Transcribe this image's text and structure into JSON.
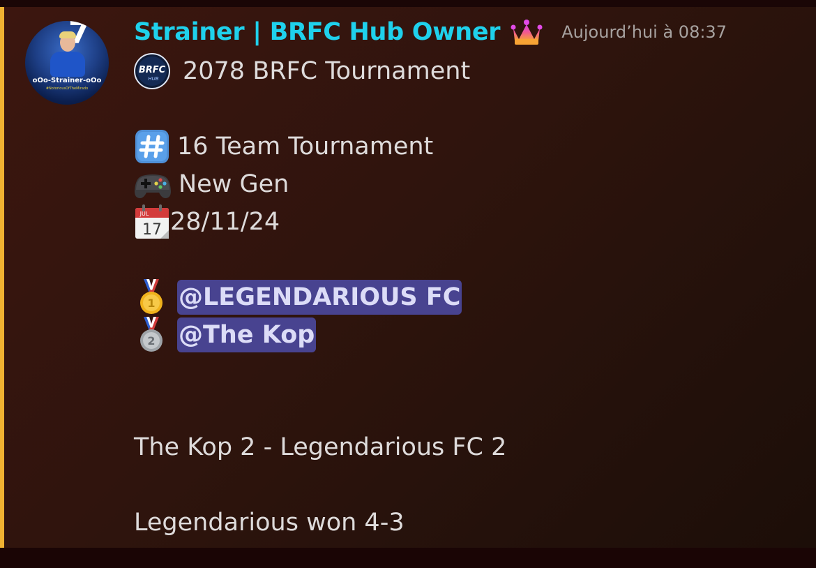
{
  "message": {
    "author": {
      "display_name": "Strainer | BRFC Hub Owner",
      "name_color": "#1fd1ec",
      "badge_icon": "crown-icon",
      "avatar": {
        "number": "7",
        "caption": "oOo-Strainer-oOo",
        "subcaption": "#NotoriousOfTheMirado"
      }
    },
    "timestamp": "Aujourd’hui à 08:37",
    "server_icon_text": "BRFC",
    "server_icon_subtext": "HUB",
    "title": "2078 BRFC Tournament",
    "details": [
      {
        "icon": "hash-keycap-icon",
        "text": "16 Team Tournament"
      },
      {
        "icon": "gamepad-icon",
        "text": "New Gen"
      },
      {
        "icon": "calendar-icon",
        "text": "28/11/24",
        "calendar_month": "JUL",
        "calendar_day": "17"
      }
    ],
    "placements": [
      {
        "icon": "gold-medal-icon",
        "place": "1",
        "mention": "@LEGENDARIOUS FC"
      },
      {
        "icon": "silver-medal-icon",
        "place": "2",
        "mention": "@The Kop"
      }
    ],
    "score_line": "The Kop 2 - Legendarious FC 2",
    "result_line": "Legendarious won 4-3"
  },
  "colors": {
    "highlight_bar": "#f0b232",
    "mention_bg": "#484390",
    "mention_text": "#dcdcf7",
    "body_text": "#dedbdb",
    "timestamp": "#a7a2a0"
  }
}
